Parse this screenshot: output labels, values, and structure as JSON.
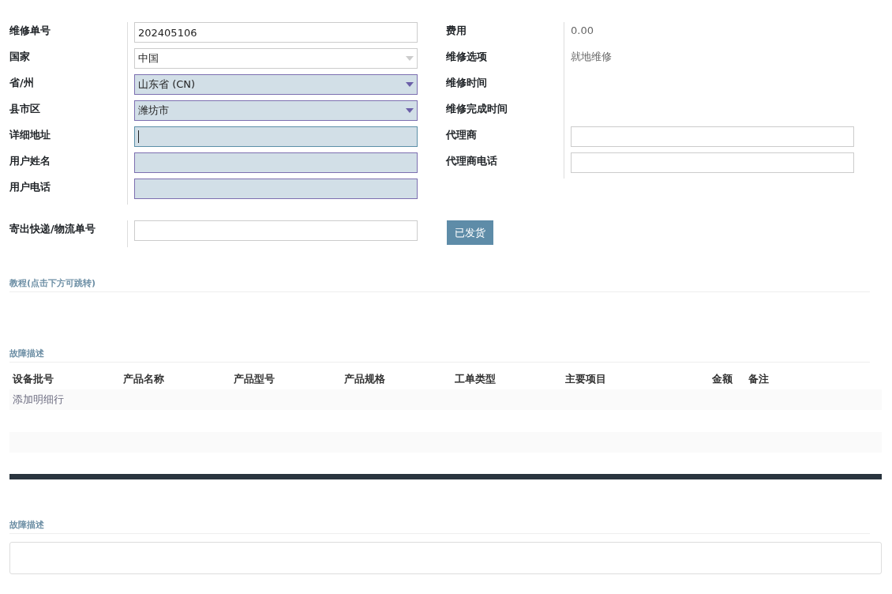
{
  "left_fields": [
    {
      "label": "维修单号",
      "kind": "input",
      "value": "202405106",
      "required": false,
      "focused": false
    },
    {
      "label": "国家",
      "kind": "select",
      "value": "中国",
      "required": false,
      "focused": false
    },
    {
      "label": "省/州",
      "kind": "select",
      "value": "山东省 (CN)",
      "required": true,
      "focused": false
    },
    {
      "label": "县市区",
      "kind": "select",
      "value": "潍坊市",
      "required": true,
      "focused": false
    },
    {
      "label": "详细地址",
      "kind": "input",
      "required": true,
      "focused": true
    },
    {
      "label": "用户姓名",
      "kind": "input",
      "required": true,
      "focused": false
    },
    {
      "label": "用户电话",
      "kind": "input",
      "required": true,
      "focused": false
    }
  ],
  "right_fields": [
    {
      "label": "费用",
      "kind": "text",
      "value": "0.00"
    },
    {
      "label": "维修选项",
      "kind": "text",
      "value": "就地维修"
    },
    {
      "label": "维修时间",
      "kind": "text"
    },
    {
      "label": "维修完成时间",
      "kind": "text"
    },
    {
      "label": "代理商",
      "kind": "input",
      "required": false,
      "focused": false
    },
    {
      "label": "代理商电话",
      "kind": "input",
      "required": false,
      "focused": false
    }
  ],
  "shipping": {
    "label": "寄出快递/物流单号",
    "field": {
      "required": false,
      "focused": false
    },
    "button": "已发货"
  },
  "tutorial_section": {
    "title": "教程(点击下方可跳转)"
  },
  "fault_section": {
    "title": "故障描述",
    "table": {
      "columns": [
        "设备批号",
        "产品名称",
        "产品型号",
        "产品规格",
        "工单类型",
        "主要项目",
        "金额",
        "备注"
      ],
      "add_row": "添加明细行"
    }
  },
  "fault_notes": {
    "title": "故障描述"
  }
}
